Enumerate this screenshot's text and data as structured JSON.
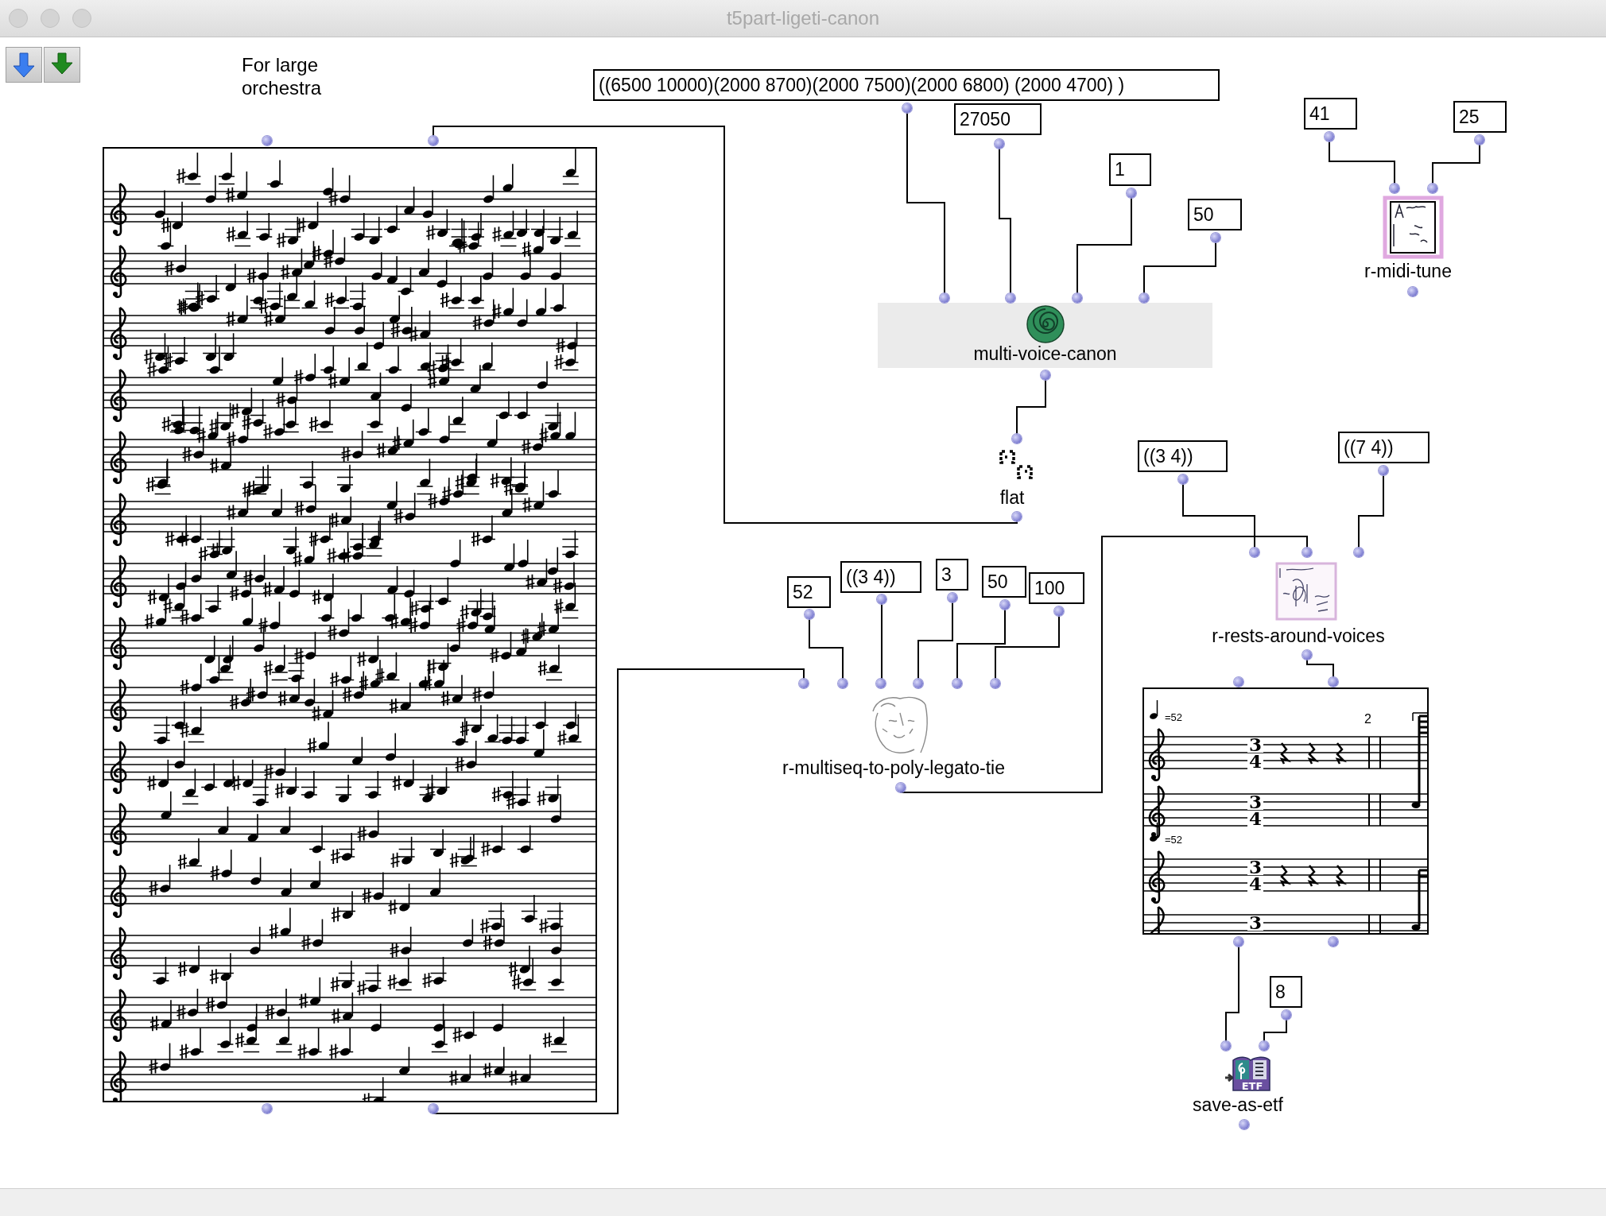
{
  "window": {
    "title": "t5part-ligeti-canon"
  },
  "comment": {
    "text": "For large orchestra"
  },
  "boxes": [
    {
      "kind": "value",
      "text": "((6500 10000)(2000 8700)(2000 7500)(2000 6800) (2000 4700) )"
    },
    {
      "kind": "value",
      "text": "27050"
    },
    {
      "kind": "value",
      "text": "1"
    },
    {
      "kind": "value",
      "text": "50"
    },
    {
      "kind": "value",
      "text": "41"
    },
    {
      "kind": "value",
      "text": "25"
    },
    {
      "kind": "patch",
      "label": "multi-voice-canon"
    },
    {
      "kind": "function",
      "label": "r-midi-tune"
    },
    {
      "kind": "function",
      "label": "flat"
    },
    {
      "kind": "value",
      "text": "((3 4))"
    },
    {
      "kind": "value",
      "text": "((7 4))"
    },
    {
      "kind": "function",
      "label": "r-rests-around-voices"
    },
    {
      "kind": "value",
      "text": "52"
    },
    {
      "kind": "value",
      "text": "((3 4))"
    },
    {
      "kind": "value",
      "text": "3"
    },
    {
      "kind": "value",
      "text": "50"
    },
    {
      "kind": "value",
      "text": "100"
    },
    {
      "kind": "function",
      "label": "r-multiseq-to-poly-legato-tie"
    },
    {
      "kind": "score"
    },
    {
      "kind": "score",
      "measure_number": "2",
      "staves": [
        {
          "tempo": "=52",
          "time": [
            "3",
            "4"
          ]
        },
        {
          "time": [
            "3",
            "4"
          ]
        },
        {
          "tempo": "=52",
          "time": [
            "3",
            "4"
          ]
        },
        {
          "time": [
            "3"
          ]
        }
      ]
    },
    {
      "kind": "value",
      "text": "8"
    },
    {
      "kind": "function",
      "label": "save-as-etf",
      "icon_text": "ETF"
    }
  ]
}
